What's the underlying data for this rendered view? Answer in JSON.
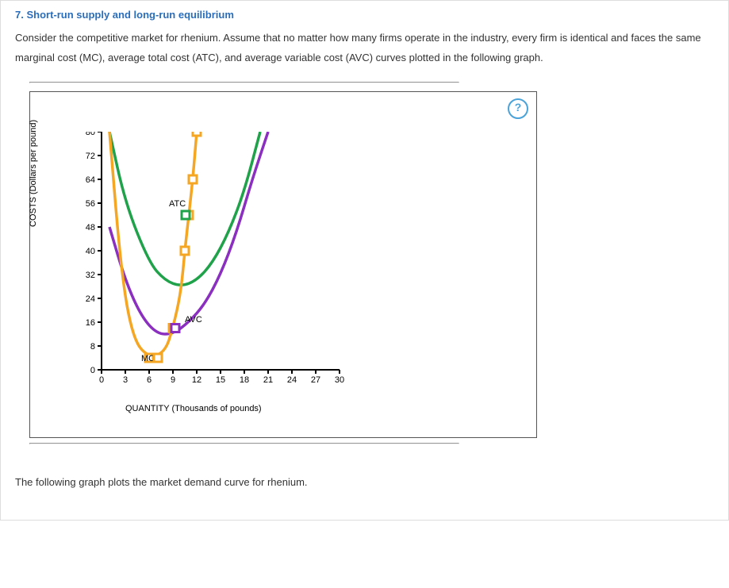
{
  "question_number": "7.",
  "question_title": "Short-run supply and long-run equilibrium",
  "description": "Consider the competitive market for rhenium. Assume that no matter how many firms operate in the industry, every firm is identical and faces the same marginal cost (MC), average total cost (ATC), and average variable cost (AVC) curves plotted in the following graph.",
  "help_label": "?",
  "footer_text": "The following graph plots the market demand curve for rhenium.",
  "chart_data": {
    "type": "line",
    "xlabel": "QUANTITY (Thousands of pounds)",
    "ylabel": "COSTS (Dollars per pound)",
    "xlim": [
      0,
      30
    ],
    "ylim": [
      0,
      80
    ],
    "x_ticks": [
      0,
      3,
      6,
      9,
      12,
      15,
      18,
      21,
      24,
      27,
      30
    ],
    "y_ticks": [
      0,
      8,
      16,
      24,
      32,
      40,
      48,
      56,
      64,
      72,
      80
    ],
    "series": [
      {
        "name": "MC",
        "color": "#f5a623",
        "points": [
          [
            1,
            80
          ],
          [
            2.5,
            32
          ],
          [
            4,
            10
          ],
          [
            6,
            4
          ],
          [
            8,
            6
          ],
          [
            9,
            14
          ],
          [
            10,
            26
          ],
          [
            10.5,
            40
          ],
          [
            11,
            52
          ],
          [
            11.5,
            64
          ],
          [
            12,
            80
          ]
        ],
        "legend_box_at": [
          7.1,
          4
        ]
      },
      {
        "name": "ATC",
        "color": "#1fa24a",
        "points": [
          [
            1,
            80
          ],
          [
            3,
            56
          ],
          [
            6,
            36
          ],
          [
            8,
            30
          ],
          [
            10,
            28
          ],
          [
            12,
            30
          ],
          [
            14,
            36
          ],
          [
            16,
            46
          ],
          [
            18,
            60
          ],
          [
            20,
            80
          ]
        ],
        "label_at": [
          8.5,
          55
        ],
        "legend_box_at": [
          10.6,
          52
        ]
      },
      {
        "name": "AVC",
        "color": "#8a2fbf",
        "points": [
          [
            1,
            48
          ],
          [
            3,
            30
          ],
          [
            5,
            18
          ],
          [
            7,
            12
          ],
          [
            9,
            12
          ],
          [
            11,
            16
          ],
          [
            13,
            22
          ],
          [
            15,
            32
          ],
          [
            17,
            46
          ],
          [
            19,
            64
          ],
          [
            21,
            80
          ]
        ],
        "label_at": [
          10.5,
          16
        ],
        "legend_box_at": [
          9.3,
          14
        ]
      }
    ],
    "mc_handles_y": [
      4,
      14,
      40,
      52,
      64,
      80
    ]
  }
}
